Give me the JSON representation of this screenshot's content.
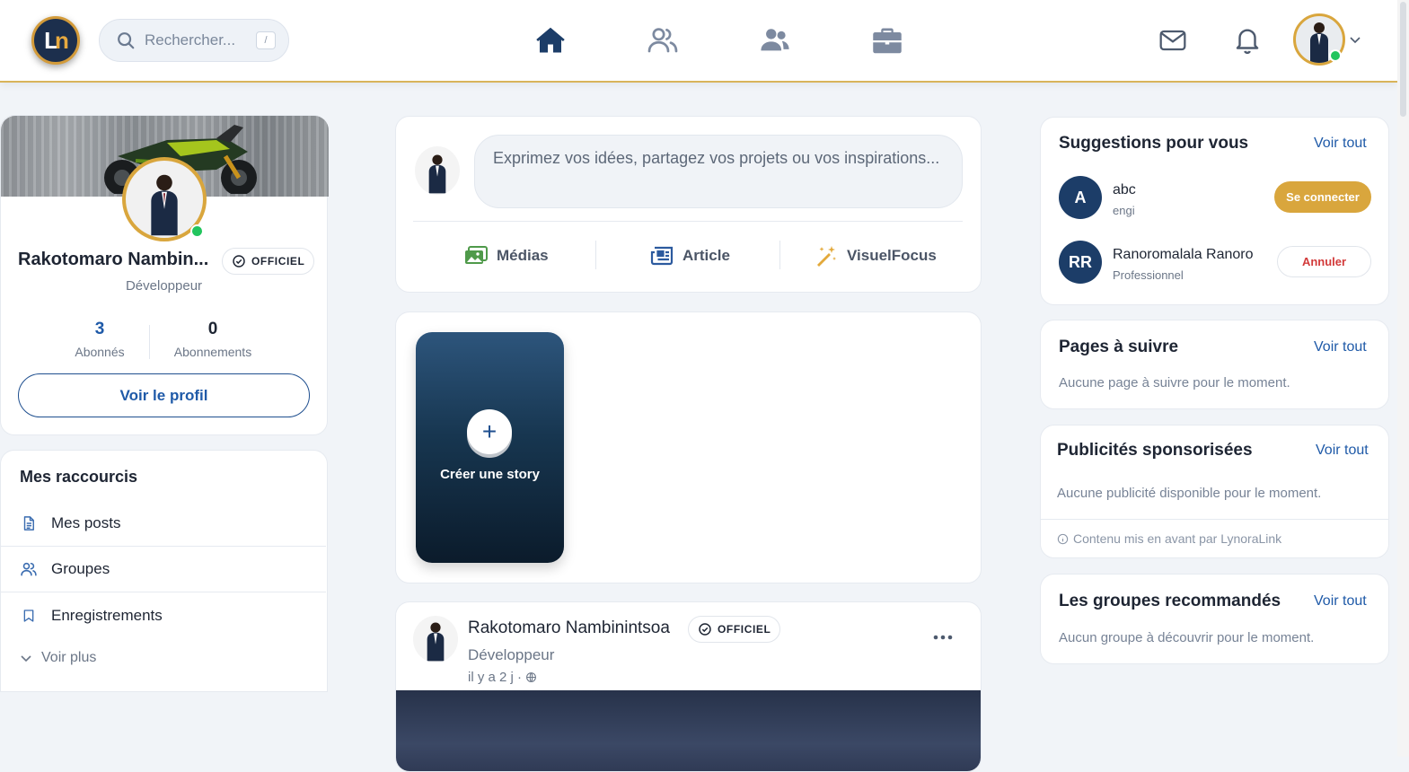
{
  "header": {
    "logo_text": "Ln",
    "search_placeholder": "Rechercher...",
    "search_shortcut": "/"
  },
  "profile": {
    "name": "Rakotomaro Nambin...",
    "badge": "OFFICIEL",
    "role": "Développeur",
    "followers_count": "3",
    "followers_label": "Abonnés",
    "following_count": "0",
    "following_label": "Abonnements",
    "view_profile": "Voir le profil"
  },
  "shortcuts": {
    "title": "Mes raccourcis",
    "items": [
      {
        "label": "Mes posts",
        "icon": "document-icon"
      },
      {
        "label": "Groupes",
        "icon": "users-icon"
      },
      {
        "label": "Enregistrements",
        "icon": "bookmark-icon"
      }
    ],
    "more": "Voir plus"
  },
  "composer": {
    "placeholder": "Exprimez vos idées, partagez vos projets ou vos inspirations...",
    "actions": [
      {
        "label": "Médias",
        "icon": "image-icon",
        "color": "#4f9a4a"
      },
      {
        "label": "Article",
        "icon": "newspaper-icon",
        "color": "#2c5a9e"
      },
      {
        "label": "VisuelFocus",
        "icon": "magic-wand-icon",
        "color": "#e3a93b"
      }
    ]
  },
  "story": {
    "create_label": "Créer une story"
  },
  "post": {
    "author": "Rakotomaro Nambinintsoa",
    "badge": "OFFICIEL",
    "role": "Développeur",
    "time": "il y a 2 j ·"
  },
  "suggestions": {
    "title": "Suggestions pour vous",
    "see_all": "Voir tout",
    "people": [
      {
        "initials": "A",
        "name": "abc",
        "subtitle": "engi",
        "action": "Se connecter"
      },
      {
        "initials": "RR",
        "name": "Ranoromalala Ranoro",
        "subtitle": "Professionnel",
        "action": "Annuler"
      }
    ]
  },
  "pages": {
    "title": "Pages à suivre",
    "see_all": "Voir tout",
    "empty": "Aucune page à suivre pour le moment."
  },
  "ads": {
    "title": "Publicités sponsorisées",
    "see_all": "Voir tout",
    "empty": "Aucune publicité disponible pour le moment.",
    "footer": "Contenu mis en avant par LynoraLink"
  },
  "groups": {
    "title": "Les groupes recommandés",
    "see_all": "Voir tout",
    "empty": "Aucun groupe à découvrir pour le moment."
  },
  "colors": {
    "accent_gold": "#d9a63d",
    "primary_blue": "#1f5aa8",
    "online_green": "#22c55e"
  }
}
